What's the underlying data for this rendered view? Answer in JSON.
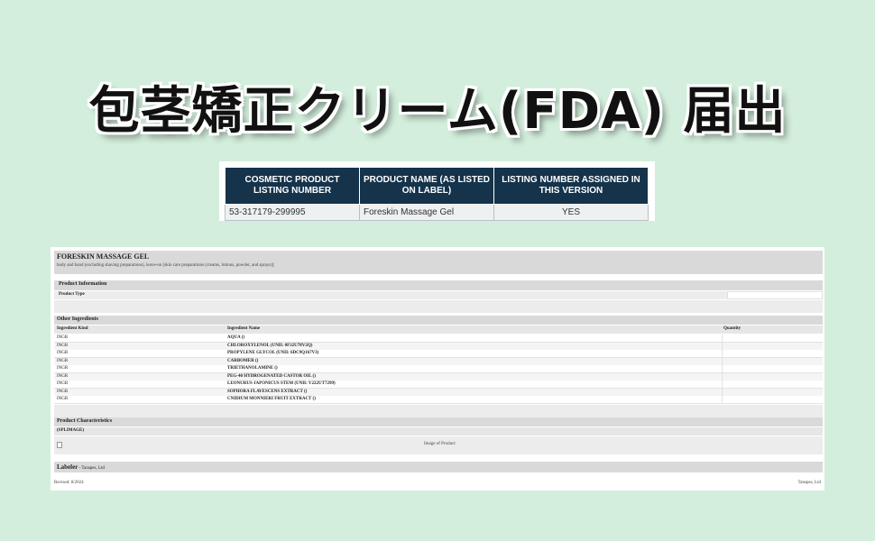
{
  "headline": "包茎矯正クリーム(FDA) 届出",
  "listing": {
    "headers": [
      "COSMETIC PRODUCT LISTING NUMBER",
      "PRODUCT NAME (AS LISTED ON LABEL)",
      "LISTING NUMBER ASSIGNED IN THIS VERSION"
    ],
    "row": [
      "53-317179-299995",
      "Foreskin Massage Gel",
      "YES"
    ]
  },
  "doc": {
    "title": "FORESKIN MASSAGE GEL",
    "subtitle": "body and hand (excluding shaving preparations), leave-on [skin care preparations (creams, lotions, powder, and sprays)]",
    "product_info_heading": "Product Information",
    "product_type_label": "Product Type",
    "other_ingredients_heading": "Other Ingredients",
    "ingredient_headers": [
      "Ingredient Kind",
      "Ingredient Name",
      "Quantity"
    ],
    "ingredients": [
      {
        "kind": "INGR",
        "name": "AQUA ()"
      },
      {
        "kind": "INGR",
        "name": "CHLOROXYLENOL (UNII: 0F32U78V2Q)"
      },
      {
        "kind": "INGR",
        "name": "PROPYLENE GLYCOL (UNII: 6DC9Q167V3)"
      },
      {
        "kind": "INGR",
        "name": "CARBOMER ()"
      },
      {
        "kind": "INGR",
        "name": "TRIETHANOLAMINE ()"
      },
      {
        "kind": "INGR",
        "name": "PEG-40 HYDROGENATED CASTOR OIL ()"
      },
      {
        "kind": "INGR",
        "name": "LEONURUS JAPONICUS STEM (UNII: V222UT7299)"
      },
      {
        "kind": "INGR",
        "name": "SOPHORA FLAVESCENS EXTRACT ()"
      },
      {
        "kind": "INGR",
        "name": "CNIDIUM MONNIERI FRUIT EXTRACT ()"
      }
    ],
    "product_characteristics_heading": "Product Characteristics",
    "splimage": "(SPLIMAGE)",
    "image_caption": "Image of Product",
    "labeler_label": "Labeler",
    "labeler_name": " - Tanspes, Ltd",
    "revised": "Revised: 8/2024",
    "footer_company": "Tanspes, Ltd"
  }
}
